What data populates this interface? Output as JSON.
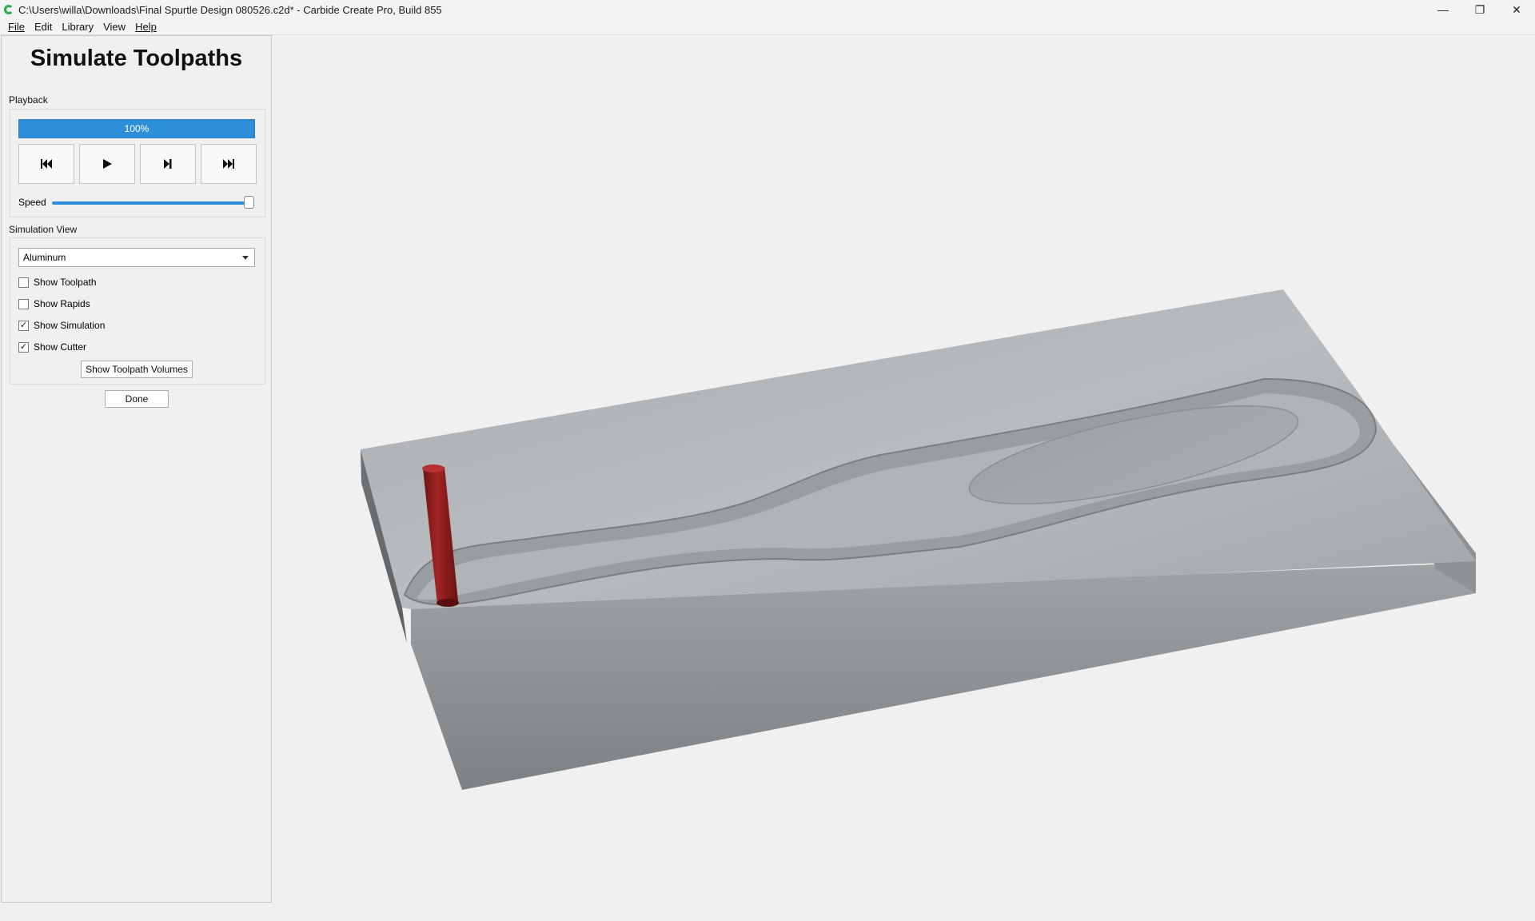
{
  "window": {
    "title": "C:\\Users\\willa\\Downloads\\Final Spurtle Design 080526.c2d* - Carbide Create Pro, Build 855",
    "controls": {
      "minimize": "—",
      "restore": "❐",
      "close": "✕"
    }
  },
  "menu": [
    {
      "label": "File"
    },
    {
      "label": "Edit"
    },
    {
      "label": "Library"
    },
    {
      "label": "View"
    },
    {
      "label": "Help"
    }
  ],
  "panel": {
    "title": "Simulate Toolpaths",
    "playback": {
      "label": "Playback",
      "progress_text": "100%",
      "progress_value": 1.0,
      "buttons": [
        "skip-to-start",
        "play",
        "step",
        "skip-to-end"
      ],
      "speed_label": "Speed",
      "speed_value": 1.0
    },
    "simulation_view": {
      "label": "Simulation View",
      "material": "Aluminum",
      "checks": [
        {
          "label": "Show Toolpath",
          "checked": false
        },
        {
          "label": "Show Rapids",
          "checked": false
        },
        {
          "label": "Show Simulation",
          "checked": true
        },
        {
          "label": "Show Cutter",
          "checked": true
        }
      ],
      "volumes_button": "Show Toolpath Volumes"
    },
    "done_button": "Done"
  },
  "colors": {
    "accent": "#2e8fd8",
    "cutter": "#8b1a1a",
    "stock": "#b4b8bb"
  }
}
